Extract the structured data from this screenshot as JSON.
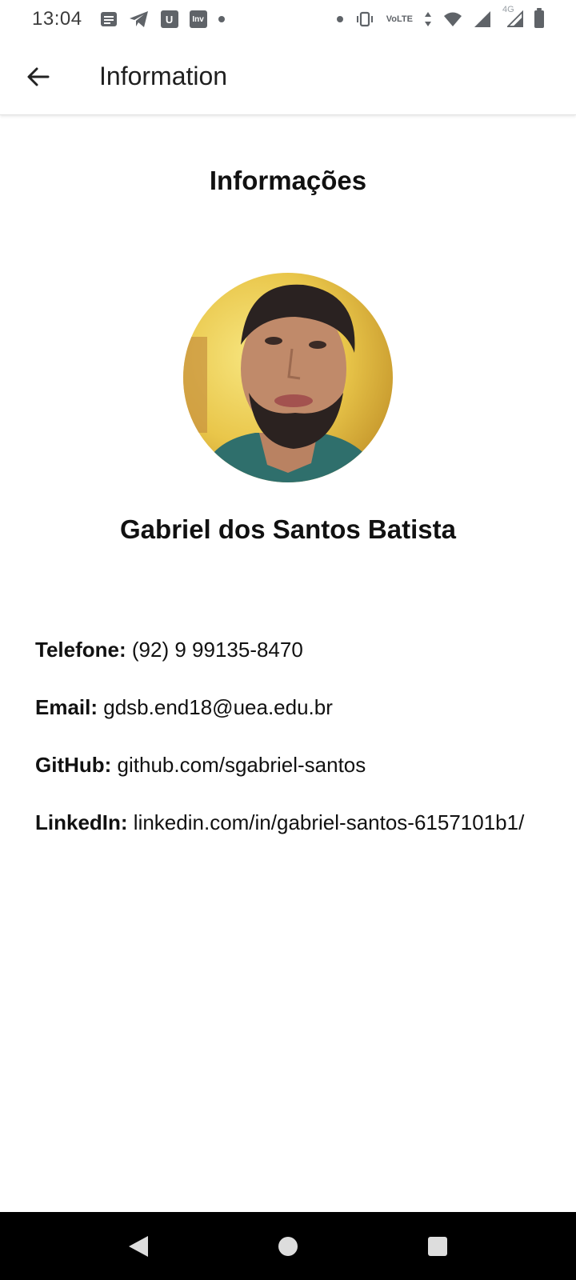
{
  "status_bar": {
    "time": "13:04",
    "notification_icons": [
      "notes-icon",
      "telegram-icon",
      "u-app-icon",
      "inv-app-icon",
      "more-dot-icon"
    ],
    "system_icons": [
      "dot-icon",
      "vibrate-icon",
      "volte-icon",
      "data-arrows-icon",
      "wifi-icon",
      "signal-icon",
      "signal-4g-icon",
      "battery-icon"
    ],
    "u_label": "U",
    "inv_label": "Inv",
    "volte_top": "Vo",
    "volte_bottom": "LTE",
    "net_label": "4G"
  },
  "app_bar": {
    "title": "Information",
    "back_icon": "arrow-back-icon"
  },
  "main": {
    "section_title": "Informações",
    "name": "Gabriel dos Santos Batista",
    "fields": [
      {
        "label": "Telefone:",
        "value": "(92) 9 99135-8470"
      },
      {
        "label": "Email:",
        "value": "gdsb.end18@uea.edu.br"
      },
      {
        "label": "GitHub:",
        "value": "github.com/sgabriel-santos"
      },
      {
        "label": "LinkedIn:",
        "value": "linkedin.com/in/gabriel-santos-6157101b1/"
      }
    ]
  },
  "nav_bar": {
    "buttons": [
      "back-triangle-icon",
      "home-circle-icon",
      "recents-square-icon"
    ]
  },
  "colors": {
    "status_icon": "#5f6368",
    "text": "#111111",
    "nav_background": "#000000",
    "nav_icon": "#dddddd"
  }
}
